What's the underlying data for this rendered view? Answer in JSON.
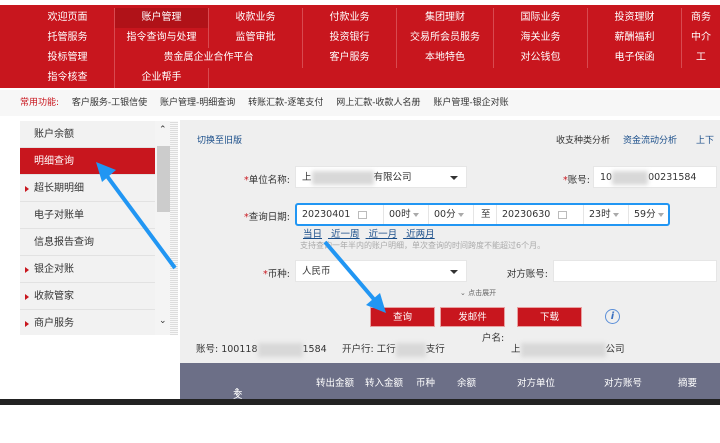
{
  "topnav": {
    "rows": [
      [
        "欢迎页面",
        "账户管理",
        "收款业务",
        "付款业务",
        "集团理财",
        "国际业务",
        "投资理财",
        "商务"
      ],
      [
        "托管服务",
        "指令查询与处理",
        "监管审批",
        "投资银行",
        "交易所会员服务",
        "海关业务",
        "薪酬福利",
        "中介"
      ],
      [
        "投标管理",
        "贵金属企业合作平台",
        "客户服务",
        "本地特色",
        "对公钱包",
        "电子保函",
        "工"
      ],
      [
        "指令核查",
        "企业帮手"
      ]
    ]
  },
  "common": {
    "label": "常用功能:",
    "items": [
      "客户服务-工银信使",
      "账户管理-明细查询",
      "转账汇款-逐笔支付",
      "网上汇款-收款人名册",
      "账户管理-银企对账"
    ]
  },
  "sidebar": {
    "items": [
      {
        "label": "账户余额",
        "arrow": false
      },
      {
        "label": "明细查询",
        "arrow": false,
        "active": true
      },
      {
        "label": "超长期明细",
        "arrow": true
      },
      {
        "label": "电子对账单",
        "arrow": false
      },
      {
        "label": "信息报告查询",
        "arrow": false
      },
      {
        "label": "银企对账",
        "arrow": true
      },
      {
        "label": "收款管家",
        "arrow": true
      },
      {
        "label": "商户服务",
        "arrow": true
      }
    ]
  },
  "main": {
    "switch_old": "切换至旧版",
    "links": [
      "收支种类分析",
      "资金流动分析",
      "上下"
    ],
    "unit_label": "单位名称:",
    "unit_prefix": "上",
    "unit_suffix": "有限公司",
    "account_label": "账号:",
    "account_prefix": "10",
    "account_suffix": "00231584",
    "date_label": "查询日期:",
    "start_date": "20230401",
    "start_hour": "00时",
    "start_min": "00分",
    "to": "至",
    "end_date": "20230630",
    "end_hour": "23时",
    "end_min": "59分",
    "quick": [
      "当日",
      "近一周",
      "近一月",
      "近两月"
    ],
    "hint": "支持查询一年半内的账户明细，单次查询的时间跨度不能超过6个月。",
    "currency_label": "币种:",
    "currency": "人民币",
    "counter_label": "对方账号:",
    "expand": "点击展开",
    "buttons": {
      "query": "查询",
      "mail": "发邮件",
      "download": "下载"
    },
    "info_account_prefix": "账号: 100118",
    "info_account_suffix": "1584",
    "bank_label": "开户行: 工行",
    "bank_suffix": "支行",
    "name_label": "户名:",
    "name_prefix": "上",
    "name_suffix": "公司"
  },
  "table": {
    "headers": [
      "交易时间",
      "转出金额",
      "转入金额",
      "币种",
      "余额",
      "对方单位",
      "对方账号",
      "摘要"
    ]
  },
  "colors": {
    "brand": "#c8161e",
    "highlight": "#2196f3",
    "table_header": "#6c6f87"
  }
}
